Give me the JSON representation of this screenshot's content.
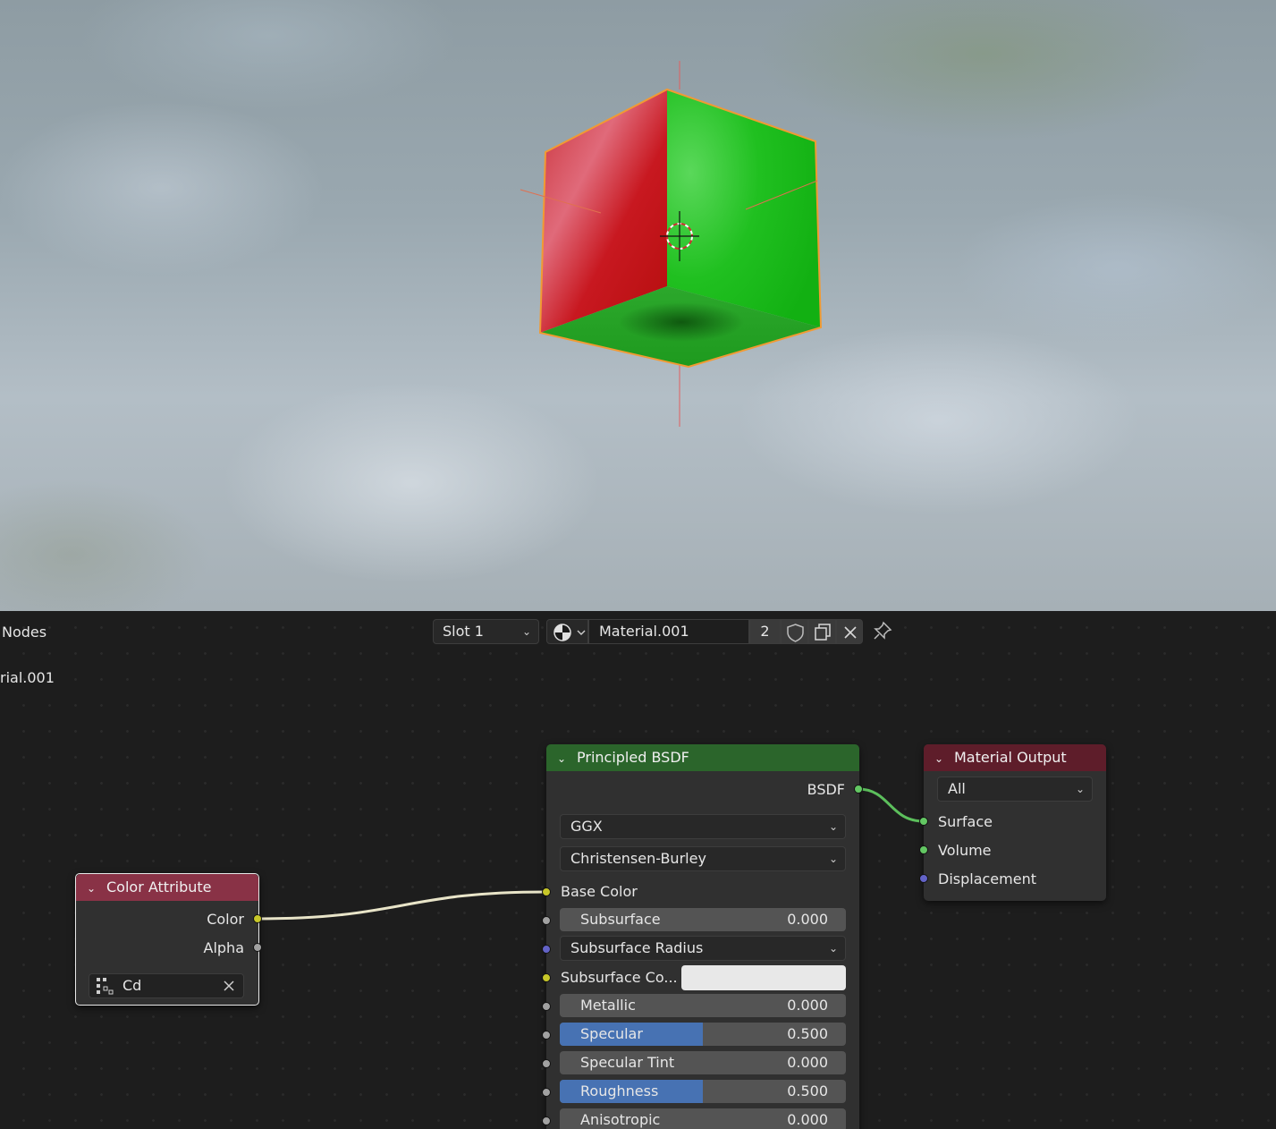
{
  "header": {
    "editor_label": "Nodes",
    "tree_path": "rial.001",
    "slot": "Slot 1",
    "material_name": "Material.001",
    "material_users": "2"
  },
  "nodes": {
    "color_attribute": {
      "title": "Color Attribute",
      "outputs": [
        "Color",
        "Alpha"
      ],
      "attribute_name": "Cd"
    },
    "principled_bsdf": {
      "title": "Principled BSDF",
      "output": "BSDF",
      "distribution": "GGX",
      "subsurface_method": "Christensen-Burley",
      "base_color_label": "Base Color",
      "subsurface": {
        "label": "Subsurface",
        "value": "0.000"
      },
      "subsurface_radius": "Subsurface Radius",
      "subsurface_color_label": "Subsurface Co...",
      "subsurface_color": "#e8e8e8",
      "metallic": {
        "label": "Metallic",
        "value": "0.000"
      },
      "specular": {
        "label": "Specular",
        "value": "0.500",
        "fraction": 0.5
      },
      "specular_tint": {
        "label": "Specular Tint",
        "value": "0.000"
      },
      "roughness": {
        "label": "Roughness",
        "value": "0.500",
        "fraction": 0.5
      },
      "anisotropic": {
        "label": "Anisotropic",
        "value": "0.000"
      }
    },
    "material_output": {
      "title": "Material Output",
      "target": "All",
      "inputs": [
        "Surface",
        "Volume",
        "Displacement"
      ]
    }
  },
  "colors": {
    "color_node_header": "#893246",
    "shader_node_header": "#2b652b",
    "output_node_header": "#5e1d2a",
    "accent_blue": "#4772b3",
    "cube_green": "#19b519",
    "cube_red": "#c41a1a",
    "selection_outline": "#f19a33"
  }
}
